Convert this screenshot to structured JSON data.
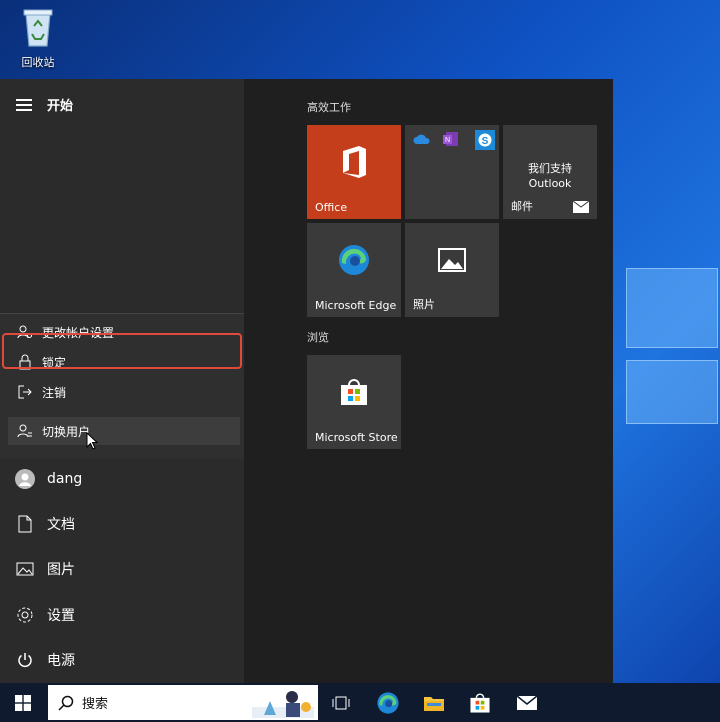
{
  "desktop": {
    "recycle_bin_label": "回收站"
  },
  "start_menu": {
    "title": "开始",
    "account_flyout": [
      {
        "label": "更改帐户设置",
        "icon": "account-settings-icon"
      },
      {
        "label": "锁定",
        "icon": "lock-icon"
      },
      {
        "label": "注销",
        "icon": "sign-out-icon"
      },
      {
        "label": "切换用户",
        "icon": "switch-user-icon"
      }
    ],
    "rail": [
      {
        "label": "dang",
        "icon": "user-avatar-icon"
      },
      {
        "label": "文档",
        "icon": "document-icon"
      },
      {
        "label": "图片",
        "icon": "pictures-icon"
      },
      {
        "label": "设置",
        "icon": "gear-icon"
      },
      {
        "label": "电源",
        "icon": "power-icon"
      }
    ],
    "groups": [
      {
        "label": "高效工作"
      },
      {
        "label": "浏览"
      }
    ],
    "tiles": {
      "office": "Office",
      "mail_title_line1": "我们支持",
      "mail_title_line2": "Outlook",
      "mail": "邮件",
      "edge": "Microsoft Edge",
      "photos": "照片",
      "store": "Microsoft Store"
    }
  },
  "taskbar": {
    "search_label": "搜索",
    "icons": [
      "task-view-icon",
      "edge-icon",
      "file-explorer-icon",
      "store-icon",
      "mail-icon"
    ]
  },
  "colors": {
    "office_tile": "#c43e1c",
    "highlight": "#e04a3a",
    "tile_bg": "#3a3a3a"
  }
}
